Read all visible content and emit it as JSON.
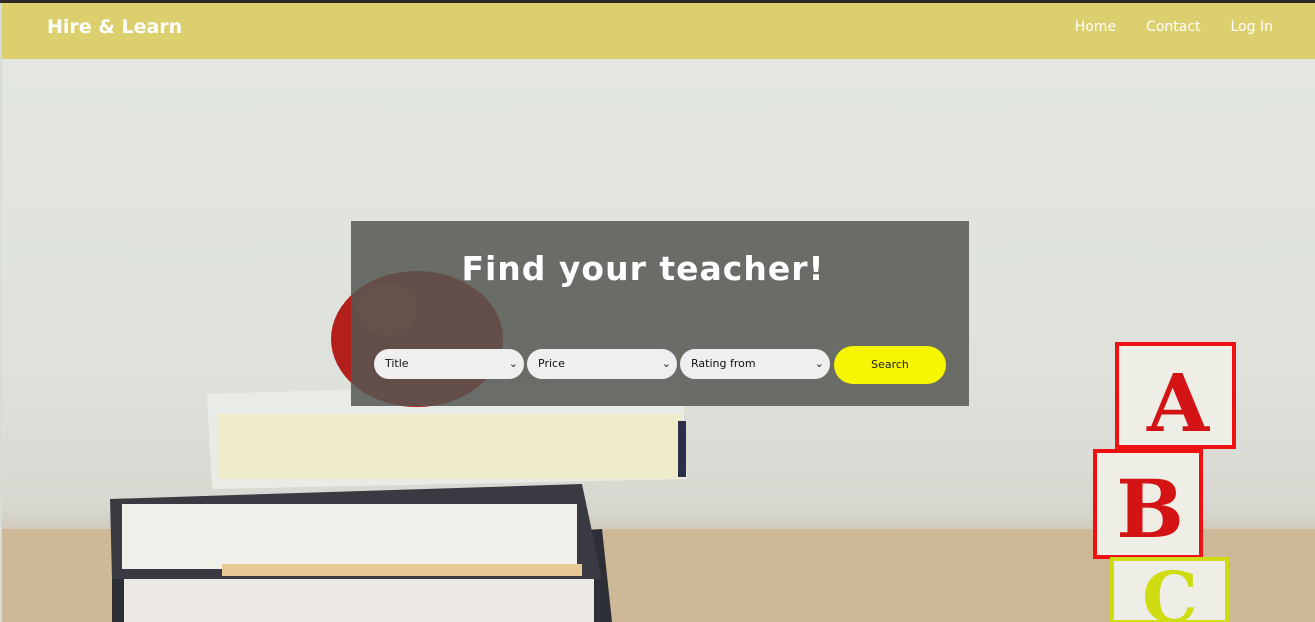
{
  "navbar": {
    "brand": "Hire & Learn",
    "links": [
      "Home",
      "Contact",
      "Log In"
    ]
  },
  "search": {
    "title": "Find your teacher!",
    "filters": [
      "Title",
      "Price",
      "Rating from"
    ],
    "button_label": "Search"
  },
  "colors": {
    "navbar_bg": "#dcd06e",
    "button_bg": "#f6f600",
    "panel_bg": "#555752"
  },
  "hero_blocks": [
    "A",
    "B",
    "C"
  ]
}
